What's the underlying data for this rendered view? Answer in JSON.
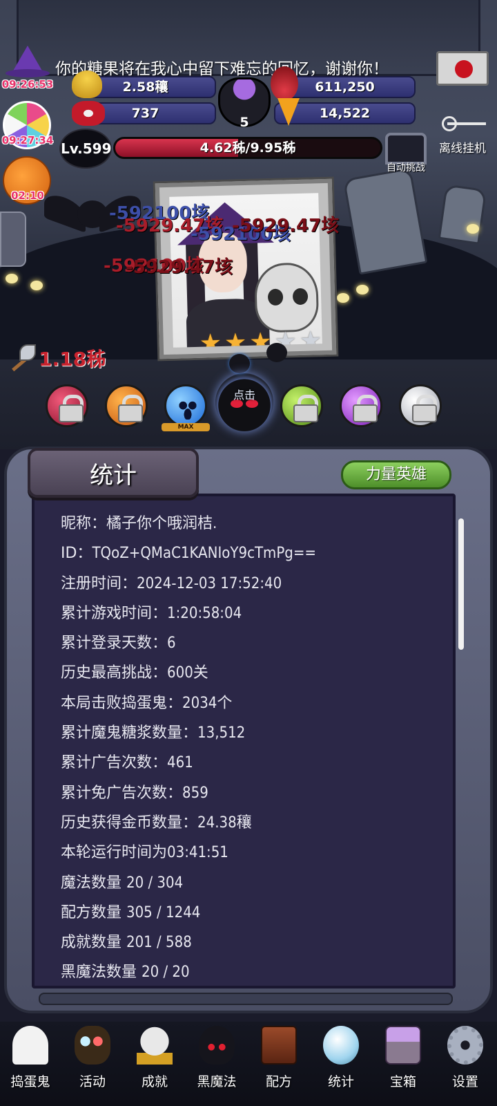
{
  "header": {
    "message": "你的糖果将在我心中留下难忘的回忆，谢谢你！",
    "timers": {
      "hat": "09:26:53",
      "candy": "09:27:34",
      "pumpkin": "02:10"
    },
    "resources": {
      "gold": "2.58穰",
      "skull_potion": "611,250",
      "bow_skull": "737",
      "candy_corn": "14,522",
      "cauldron_count": "5"
    },
    "offline_label": "离线挂机",
    "level": "Lv.599",
    "hp_text": "4.62秭/9.95秭",
    "hp_fraction": 0.464,
    "auto_challenge_label": "自动挑战"
  },
  "battle": {
    "damage_numbers": [
      "-592100垓",
      "-5929.47垓",
      "-592100垓",
      "-5929.47垓",
      "-592100垓",
      "-5929.47垓"
    ],
    "axe_damage": "1.18秭",
    "stars": {
      "earned": 3,
      "total": 5
    }
  },
  "heroes": {
    "orbs": [
      {
        "name": "red",
        "locked": true
      },
      {
        "name": "orange",
        "locked": true
      },
      {
        "name": "blue",
        "locked": false,
        "badge": "MAX"
      },
      {
        "name": "black",
        "locked": false,
        "label": "点击"
      },
      {
        "name": "green",
        "locked": true
      },
      {
        "name": "purple",
        "locked": true
      },
      {
        "name": "white",
        "locked": true
      }
    ],
    "max_badge": "MAX",
    "tap_label": "点击"
  },
  "panel": {
    "title": "统计",
    "hero_power_button": "力量英雄",
    "stats": [
      {
        "key": "昵称：",
        "value": "橘子你个哦润桔."
      },
      {
        "key": "ID：",
        "value": "TQoZ+QMaC1KANIoY9cTmPg=="
      },
      {
        "key": "注册时间：",
        "value": "2024-12-03 17:52:40"
      },
      {
        "key": "累计游戏时间：",
        "value": "1:20:58:04"
      },
      {
        "key": "累计登录天数：",
        "value": "6"
      },
      {
        "key": "历史最高挑战：",
        "value": "600关"
      },
      {
        "key": "本局击败捣蛋鬼：",
        "value": "2034个"
      },
      {
        "key": "累计魔鬼糖浆数量：",
        "value": "13,512"
      },
      {
        "key": "累计广告次数：",
        "value": "461"
      },
      {
        "key": "累计免广告次数：",
        "value": "859"
      },
      {
        "key": "历史获得金币数量：",
        "value": "24.38穰"
      },
      {
        "key": "本轮运行时间为",
        "value": "03:41:51"
      },
      {
        "key": "魔法数量 ",
        "value": "20 / 304"
      },
      {
        "key": "配方数量 ",
        "value": "305 / 1244"
      },
      {
        "key": "成就数量 ",
        "value": "201 / 588"
      },
      {
        "key": "黑魔法数量 ",
        "value": "20 / 20"
      }
    ]
  },
  "nav": {
    "items": [
      {
        "label": "捣蛋鬼",
        "icon": "ghost-icon"
      },
      {
        "label": "活动",
        "icon": "activity-icon"
      },
      {
        "label": "成就",
        "icon": "skull-trophy-icon"
      },
      {
        "label": "黑魔法",
        "icon": "black-magic-icon"
      },
      {
        "label": "配方",
        "icon": "recipe-book-icon"
      },
      {
        "label": "统计",
        "icon": "crystal-ball-icon"
      },
      {
        "label": "宝箱",
        "icon": "chest-icon"
      },
      {
        "label": "设置",
        "icon": "gear-icon"
      }
    ]
  },
  "colors": {
    "panel_bg": "#2b2747",
    "hp_fill": "#d8344e",
    "accent_green": "#4e8f2a",
    "timer_red": "#e8326a"
  }
}
